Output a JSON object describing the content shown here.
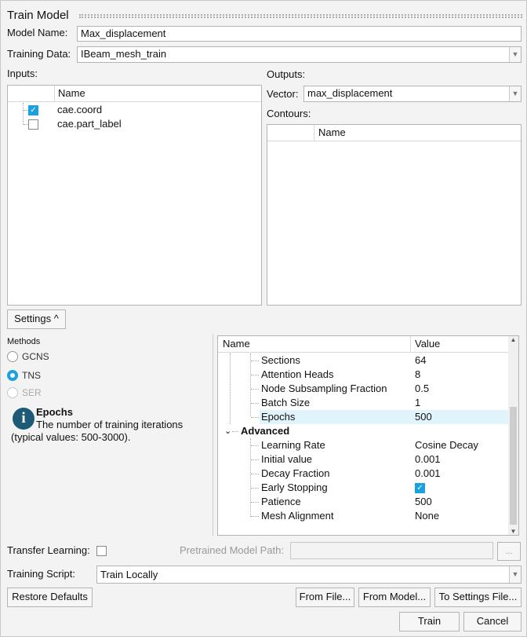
{
  "title": "Train Model",
  "model_name": {
    "label": "Model Name:",
    "value": "Max_displacement"
  },
  "training_data": {
    "label": "Training Data:",
    "value": "IBeam_mesh_train"
  },
  "inputs": {
    "label": "Inputs:",
    "header": "Name",
    "items": [
      {
        "label": "cae.coord",
        "checked": true
      },
      {
        "label": "cae.part_label",
        "checked": false
      }
    ]
  },
  "outputs": {
    "label": "Outputs:",
    "vector_label": "Vector:",
    "vector_value": "max_displacement",
    "contours_label": "Contours:",
    "contours_header": "Name"
  },
  "settings_button": "Settings ^",
  "methods": {
    "label": "Methods",
    "options": [
      {
        "label": "GCNS",
        "selected": false
      },
      {
        "label": "TNS",
        "selected": true
      },
      {
        "label": "SER",
        "selected": false,
        "disabled": true
      }
    ]
  },
  "info": {
    "title": "Epochs",
    "text1": "The number of training iterations",
    "text2": "(typical values: 500-3000)."
  },
  "params": {
    "header_name": "Name",
    "header_value": "Value",
    "rows": [
      {
        "name": "Sections",
        "value": "64"
      },
      {
        "name": "Attention Heads",
        "value": "8"
      },
      {
        "name": "Node Subsampling Fraction",
        "value": "0.5"
      },
      {
        "name": "Batch Size",
        "value": "1"
      },
      {
        "name": "Epochs",
        "value": "500"
      }
    ],
    "advanced_label": "Advanced",
    "advanced_rows": [
      {
        "name": "Learning Rate",
        "value": "Cosine Decay"
      },
      {
        "name": "Initial value",
        "value": "0.001"
      },
      {
        "name": "Decay Fraction",
        "value": "0.001"
      },
      {
        "name": "Early Stopping",
        "value": ""
      },
      {
        "name": "Patience",
        "value": "500"
      },
      {
        "name": "Mesh Alignment",
        "value": "None"
      }
    ]
  },
  "transfer_learning": {
    "label": "Transfer Learning:",
    "checked": false
  },
  "pretrained": {
    "label": "Pretrained Model Path:",
    "value": "",
    "browse": "..."
  },
  "training_script": {
    "label": "Training Script:",
    "value": "Train Locally"
  },
  "buttons": {
    "restore": "Restore Defaults",
    "from_file": "From File...",
    "from_model": "From Model...",
    "to_settings": "To Settings File...",
    "train": "Train",
    "cancel": "Cancel"
  },
  "colors": {
    "accent": "#1aa1e0",
    "selected_row": "#e1f4fb"
  }
}
